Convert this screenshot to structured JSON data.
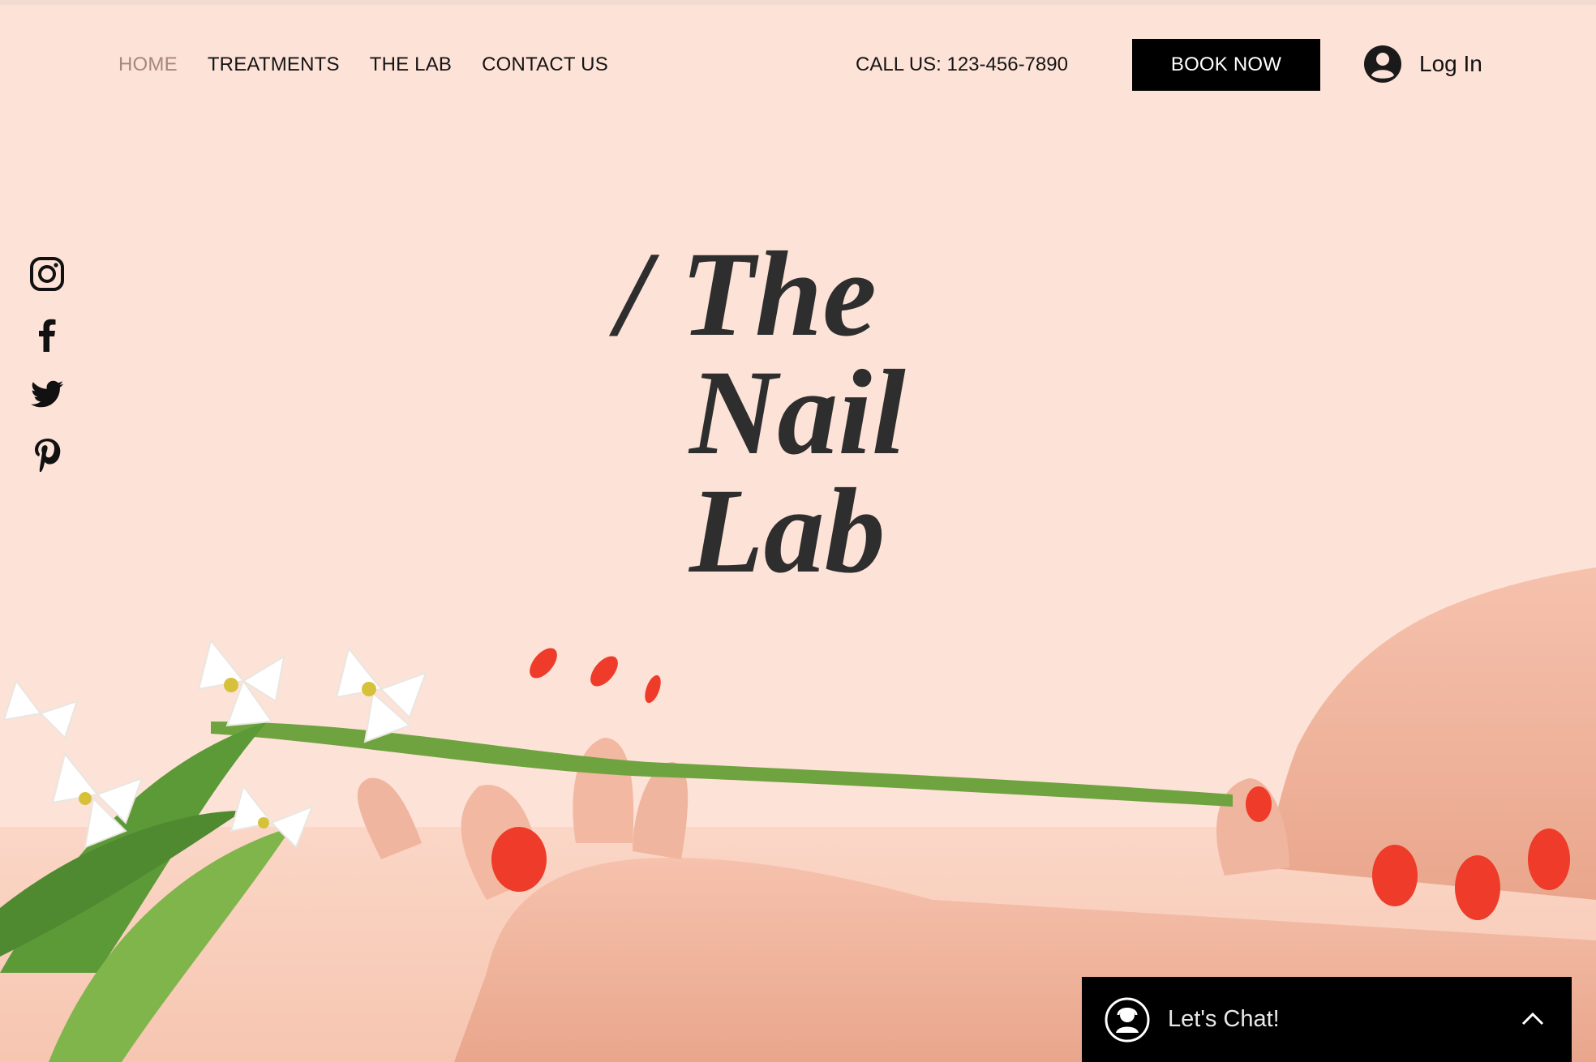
{
  "nav": {
    "items": [
      {
        "label": "HOME",
        "active": true
      },
      {
        "label": "TREATMENTS",
        "active": false
      },
      {
        "label": "THE LAB",
        "active": false
      },
      {
        "label": "CONTACT US",
        "active": false
      }
    ],
    "active_color": "#a6887b"
  },
  "header": {
    "call_label": "CALL US:  123-456-7890",
    "book_label": "BOOK NOW",
    "login_label": "Log In",
    "login_icon": "user-avatar-icon"
  },
  "social": {
    "icons": [
      "instagram-icon",
      "facebook-icon",
      "twitter-icon",
      "pinterest-icon"
    ]
  },
  "hero": {
    "line1": "/ The",
    "line2": "Nail",
    "line3": "Lab",
    "background_color": "#fde2d7",
    "nail_color": "#ee3b2a"
  },
  "chat": {
    "label": "Let's Chat!",
    "icons": [
      "chat-agent-icon",
      "chevron-up-icon"
    ]
  }
}
